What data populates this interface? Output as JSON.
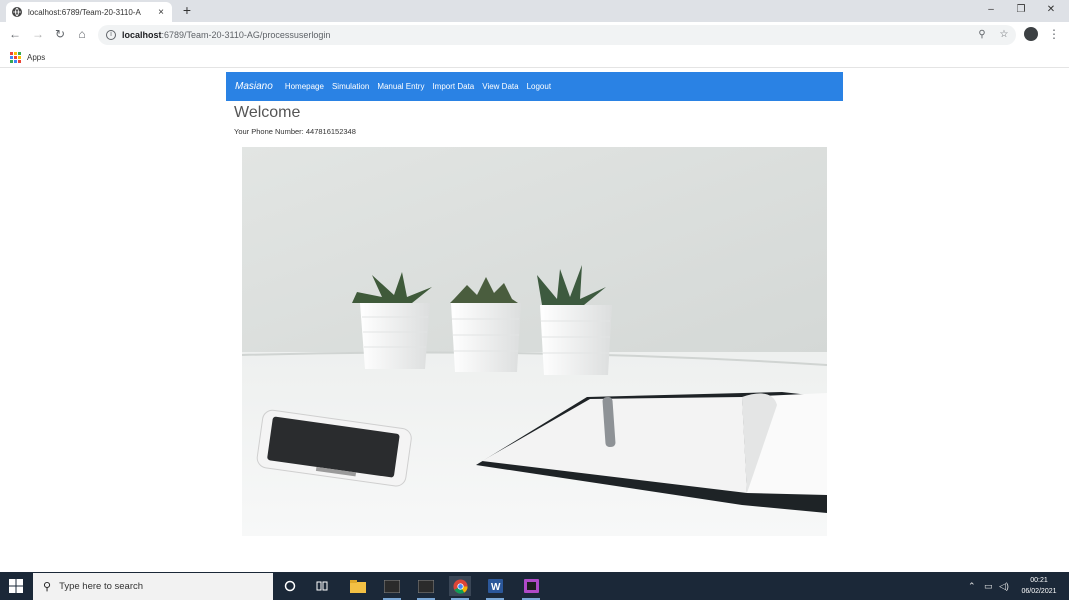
{
  "browser": {
    "tab_title": "localhost:6789/Team-20-3110-A",
    "tab_close": "×",
    "new_tab": "+",
    "url_host": "localhost",
    "url_rest": ":6789/Team-20-3110-AG/processuserlogin",
    "bookmarks": {
      "apps_label": "Apps"
    },
    "window": {
      "minimize": "–",
      "restore": "❐",
      "close": "✕"
    }
  },
  "nav": {
    "brand": "Masiano",
    "links": [
      "Homepage",
      "Simulation",
      "Manual Entry",
      "Import Data",
      "View Data",
      "Logout"
    ]
  },
  "main": {
    "heading": "Welcome",
    "phone_text": "Your Phone Number: 447816152348"
  },
  "taskbar": {
    "search_placeholder": "Type here to search",
    "time": "00:21",
    "date": "06/02/2021"
  },
  "colors": {
    "navbar": "#2a82e4",
    "taskbar": "#1b2838",
    "tab_strip": "#dee1e6"
  },
  "icons": [
    "globe-icon",
    "back-icon",
    "forward-icon",
    "reload-icon",
    "home-icon",
    "info-icon",
    "zoom-icon",
    "star-icon",
    "profile-icon",
    "menu-icon",
    "apps-grid-icon",
    "windows-start-icon",
    "search-icon",
    "cortana-icon",
    "task-view-icon",
    "file-explorer-icon",
    "terminal-icon",
    "chrome-icon",
    "word-icon",
    "ide-icon"
  ]
}
